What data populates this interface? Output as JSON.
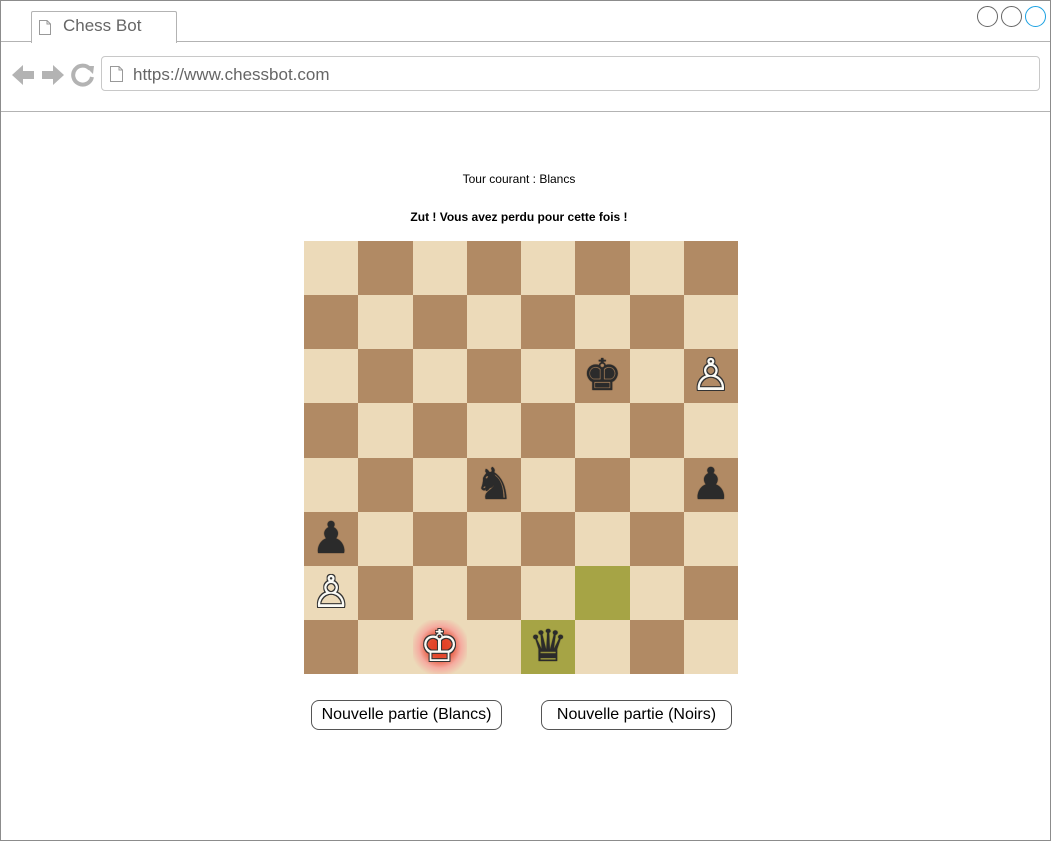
{
  "browser": {
    "tab_title": "Chess Bot",
    "url": "https://www.chessbot.com",
    "icons": [
      "back-arrow-icon",
      "forward-arrow-icon",
      "reload-icon",
      "page-icon"
    ]
  },
  "game": {
    "turn_text": "Tour courant : Blancs",
    "message": "Zut ! Vous avez perdu pour cette fois !",
    "board": [
      [
        "",
        "",
        "",
        "",
        "",
        "",
        "",
        ""
      ],
      [
        "",
        "",
        "",
        "",
        "",
        "",
        "",
        ""
      ],
      [
        "",
        "",
        "",
        "",
        "",
        "♚",
        "",
        "♙"
      ],
      [
        "",
        "",
        "",
        "",
        "",
        "",
        "",
        ""
      ],
      [
        "",
        "",
        "",
        "♞",
        "",
        "",
        "",
        "♟"
      ],
      [
        "♟",
        "",
        "",
        "",
        "",
        "",
        "",
        ""
      ],
      [
        "♙",
        "",
        "",
        "",
        "",
        "",
        "",
        ""
      ],
      [
        "",
        "",
        "♔",
        "",
        "♛",
        "",
        "",
        ""
      ]
    ],
    "colors": {
      "light_square": "#ecdab9",
      "dark_square": "#b18a64",
      "last_move": "#a6a445",
      "check": "#e23a20"
    },
    "new_game_white_label": "Nouvelle partie (Blancs)",
    "new_game_black_label": "Nouvelle partie (Noirs)"
  }
}
